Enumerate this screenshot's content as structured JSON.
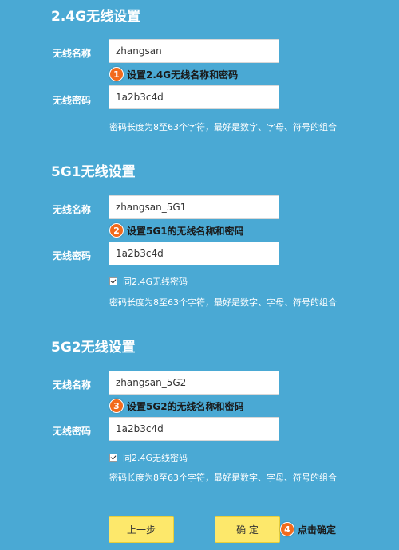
{
  "sections": [
    {
      "title": "2.4G无线设置",
      "name_label": "无线名称",
      "name_value": "zhangsan",
      "password_label": "无线密码",
      "password_value": "1a2b3c4d",
      "annotation": {
        "badge": "1",
        "text": "设置2.4G无线名称和密码"
      },
      "hint": "密码长度为8至63个字符，最好是数字、字母、符号的组合"
    },
    {
      "title": "5G1无线设置",
      "name_label": "无线名称",
      "name_value": "zhangsan_5G1",
      "password_label": "无线密码",
      "password_value": "1a2b3c4d",
      "annotation": {
        "badge": "2",
        "text": "设置5G1的无线名称和密码"
      },
      "same_password_label": "同2.4G无线密码",
      "same_password_checked": true,
      "hint": "密码长度为8至63个字符，最好是数字、字母、符号的组合"
    },
    {
      "title": "5G2无线设置",
      "name_label": "无线名称",
      "name_value": "zhangsan_5G2",
      "password_label": "无线密码",
      "password_value": "1a2b3c4d",
      "annotation": {
        "badge": "3",
        "text": "设置5G2的无线名称和密码"
      },
      "same_password_label": "同2.4G无线密码",
      "same_password_checked": true,
      "hint": "密码长度为8至63个字符，最好是数字、字母、符号的组合"
    }
  ],
  "buttons": {
    "prev_label": "上一步",
    "confirm_label": "确 定"
  },
  "confirm_annotation": {
    "badge": "4",
    "text": "点击确定"
  },
  "colors": {
    "background": "#4aa9d4",
    "button": "#fde86b",
    "badge": "#f26a1b"
  }
}
